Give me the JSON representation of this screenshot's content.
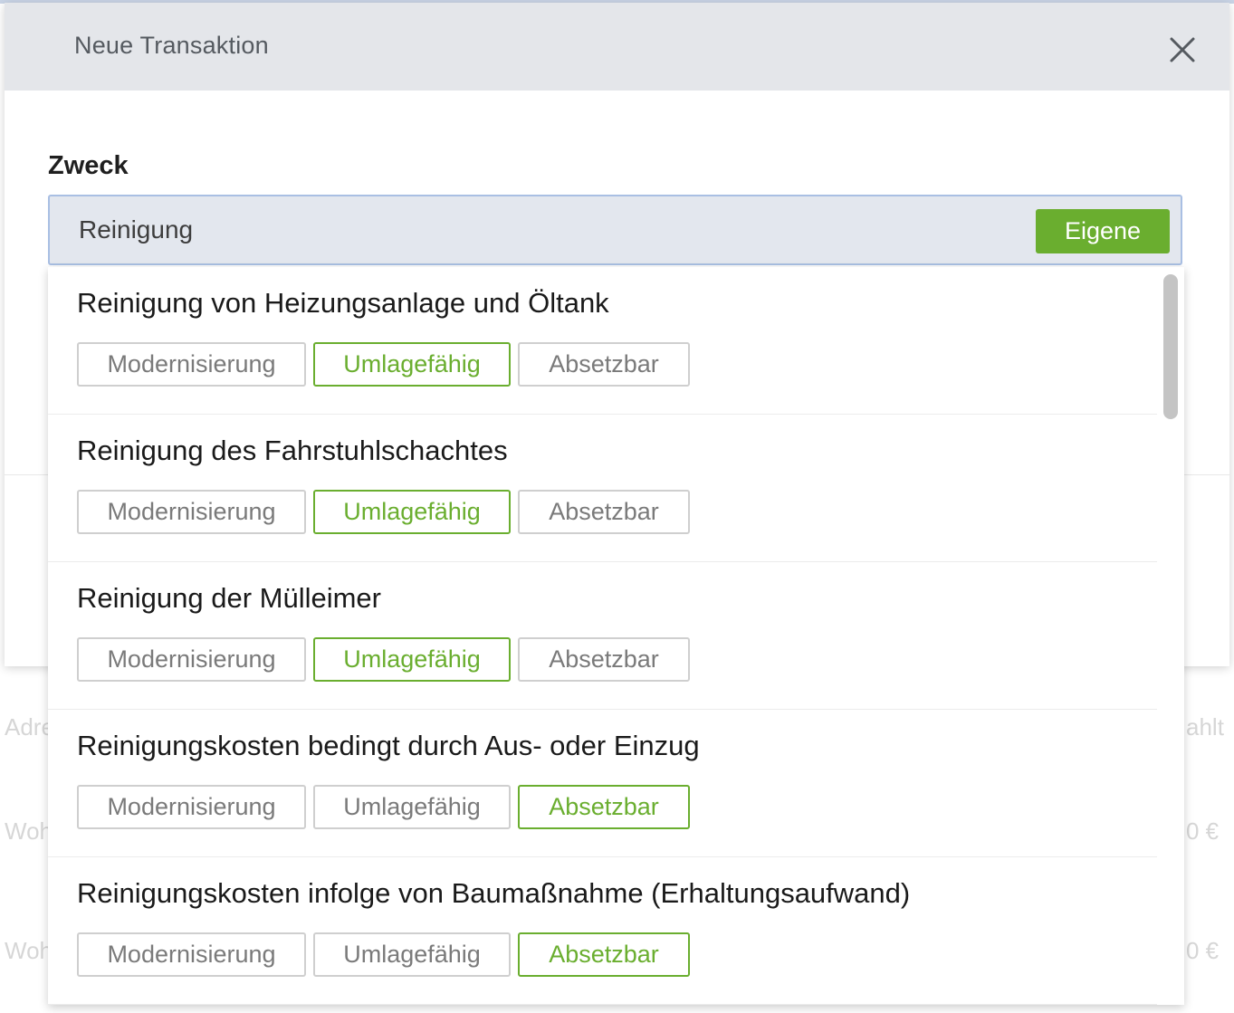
{
  "modal": {
    "title": "Neue Transaktion",
    "field_label": "Zweck",
    "search_value": "Reinigung",
    "eigene_label": "Eigene"
  },
  "background": {
    "left_labels": [
      "Adre",
      "Woh",
      "Woh"
    ],
    "right_labels": [
      "ahlt",
      "0 €",
      "0 €"
    ]
  },
  "tag_labels": {
    "modernisierung": "Modernisierung",
    "umlagefaehig": "Umlagefähig",
    "absetzbar": "Absetzbar"
  },
  "options": [
    {
      "title": "Reinigung von Heizungsanlage und Öltank",
      "modernisierung": "Modernisierung",
      "umlagefaehig": "Umlagefähig",
      "absetzbar": "Absetzbar",
      "active": "umlagefaehig"
    },
    {
      "title": "Reinigung des Fahrstuhlschachtes",
      "modernisierung": "Modernisierung",
      "umlagefaehig": "Umlagefähig",
      "absetzbar": "Absetzbar",
      "active": "umlagefaehig"
    },
    {
      "title": "Reinigung der Mülleimer",
      "modernisierung": "Modernisierung",
      "umlagefaehig": "Umlagefähig",
      "absetzbar": "Absetzbar",
      "active": "umlagefaehig"
    },
    {
      "title": "Reinigungskosten bedingt durch Aus- oder Einzug",
      "modernisierung": "Modernisierung",
      "umlagefaehig": "Umlagefähig",
      "absetzbar": "Absetzbar",
      "active": "absetzbar"
    },
    {
      "title": "Reinigungskosten infolge von Baumaßnahme (Erhaltungsaufwand)",
      "modernisierung": "Modernisierung",
      "umlagefaehig": "Umlagefähig",
      "absetzbar": "Absetzbar",
      "active": "absetzbar"
    }
  ],
  "colors": {
    "accent_green": "#6aae2f",
    "header_bg": "#e4e6ea",
    "input_bg": "#e3e7ee",
    "input_border": "#a9bfe3"
  },
  "icons": {
    "close": "close-icon"
  }
}
